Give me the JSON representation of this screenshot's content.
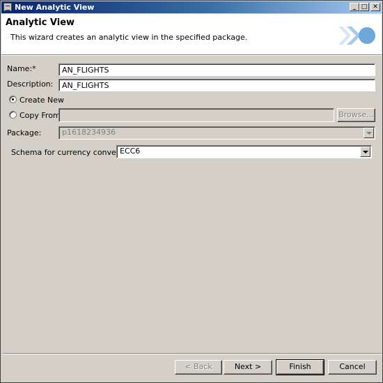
{
  "window": {
    "title": "New Analytic View"
  },
  "header": {
    "heading": "Analytic View",
    "description": "This wizard creates an analytic view in the specified package."
  },
  "form": {
    "name_label": "Name:*",
    "name_value": "AN_FLIGHTS",
    "description_label": "Description:",
    "description_value": "AN_FLIGHTS",
    "create_new_label": "Create New",
    "copy_from_label": "Copy From",
    "copy_from_value": "",
    "browse_label": "Browse...",
    "package_label": "Package:",
    "package_value": "p1618234936",
    "schema_label": "Schema for currency conversion:",
    "schema_value": "ECC6",
    "selected_option": "Create New"
  },
  "buttons": {
    "back": "< Back",
    "next": "Next >",
    "finish": "Finish",
    "cancel": "Cancel"
  },
  "colors": {
    "titlebar_start": "#0a246a",
    "titlebar_end": "#a6caf0",
    "dialog_background": "#d4d0c8",
    "logo_accent": "#6fa7d8"
  }
}
